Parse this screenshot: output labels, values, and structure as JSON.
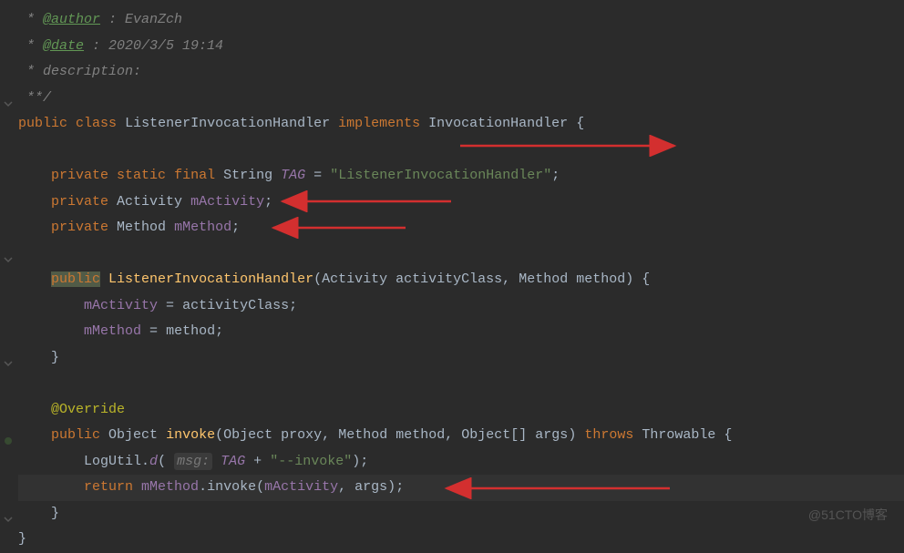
{
  "code": {
    "comment_author_tag": "@author",
    "comment_author_val": " : EvanZch",
    "comment_date_tag": "@date",
    "comment_date_val": " : 2020/3/5 19:14",
    "comment_desc": " * description:",
    "comment_end": " **/",
    "kw_public": "public",
    "kw_class": "class",
    "class_name": "ListenerInvocationHandler",
    "kw_implements": "implements",
    "iface": "InvocationHandler",
    "kw_private": "private",
    "kw_static": "static",
    "kw_final": "final",
    "type_string": "String",
    "field_tag": "TAG",
    "tag_value": "\"ListenerInvocationHandler\"",
    "type_activity": "Activity",
    "field_mactivity": "mActivity",
    "type_method": "Method",
    "field_mmethod": "mMethod",
    "ctor_name": "ListenerInvocationHandler",
    "param_activity_type": "Activity",
    "param_activity_name": "activityClass",
    "param_method_type": "Method",
    "param_method_name": "method",
    "assign_activity": "mActivity = activityClass;",
    "assign_method": "mMethod = method;",
    "anno_override": "@Override",
    "type_object": "Object",
    "method_invoke": "invoke",
    "param_proxy_t": "Object",
    "param_proxy_n": "proxy",
    "param_method2_t": "Method",
    "param_method2_n": "method",
    "param_args_t": "Object[]",
    "param_args_n": "args",
    "kw_throws": "throws",
    "type_throwable": "Throwable",
    "logutil": "LogUtil",
    "logutil_d": "d",
    "param_hint_msg": "msg:",
    "log_suffix": "\"--invoke\"",
    "kw_return": "return",
    "invoke_call": "invoke"
  },
  "watermark": "@51CTO博客"
}
